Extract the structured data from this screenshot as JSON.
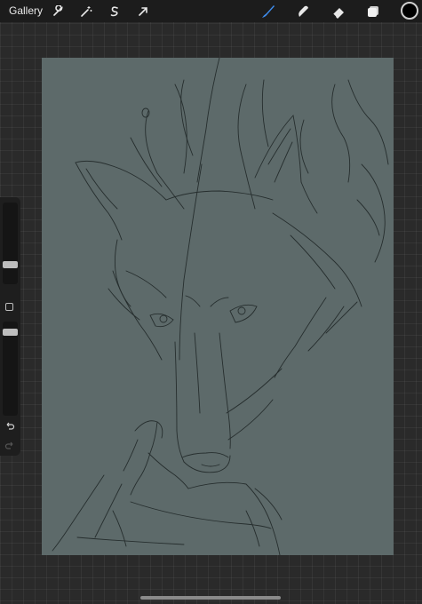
{
  "topbar": {
    "gallery_label": "Gallery",
    "tools_left": [
      "wrench-icon",
      "magic-wand-icon",
      "selection-s-icon",
      "transform-arrow-icon"
    ],
    "tools_right": [
      "brush-icon",
      "smudge-icon",
      "eraser-icon",
      "layers-icon"
    ],
    "active_tool": "brush-icon",
    "accent_color": "#3f8ef0",
    "current_color": "#000000"
  },
  "sidebar": {
    "brush_size_level": 0.23,
    "opacity_level": 0.08
  },
  "canvas": {
    "background_color": "#5d6a6a",
    "subject": "wolf-head-sketch"
  }
}
